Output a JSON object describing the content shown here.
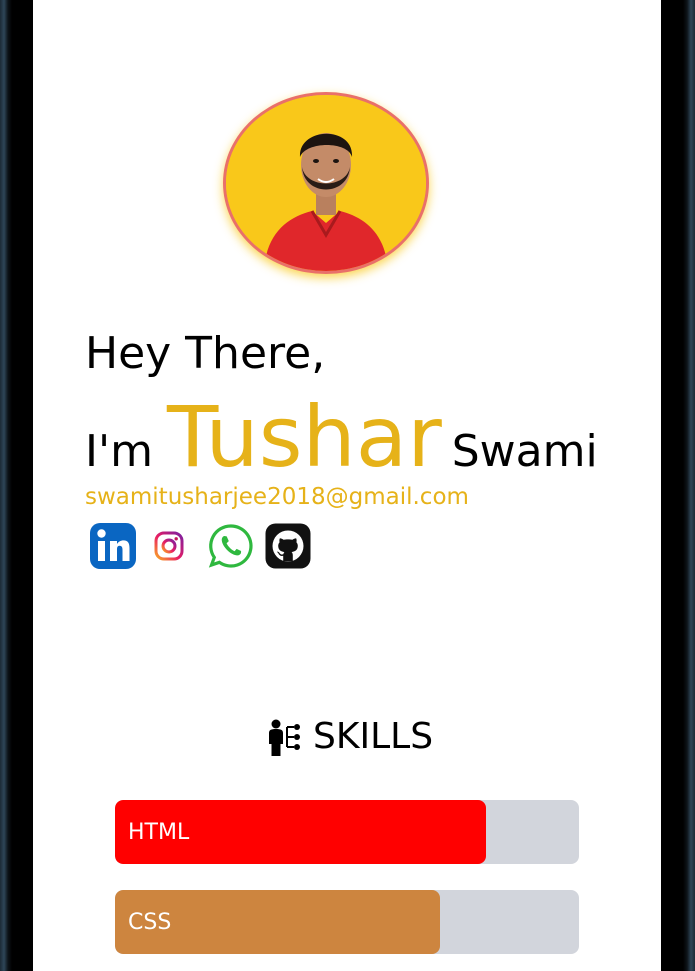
{
  "profile": {
    "greeting": "Hey There,",
    "intro_prefix": "I'm",
    "first_name": "Tushar",
    "last_name": "Swami",
    "email": "swamitusharjee2018@gmail.com"
  },
  "socials": [
    {
      "name": "LinkedIn",
      "icon": "linkedin-icon"
    },
    {
      "name": "Instagram",
      "icon": "instagram-icon"
    },
    {
      "name": "WhatsApp",
      "icon": "whatsapp-icon"
    },
    {
      "name": "GitHub",
      "icon": "github-icon"
    }
  ],
  "skills": {
    "heading": "SKILLS",
    "icon": "skills-person-icon",
    "items": [
      {
        "label": "HTML",
        "level": 0.8,
        "color": "#ff0000"
      },
      {
        "label": "CSS",
        "level": 0.7,
        "color": "#cd853f"
      }
    ]
  },
  "colors": {
    "accent": "#e6b219",
    "avatar_bg": "#f9c81a",
    "avatar_border": "#e9706a",
    "bar_track": "#d2d5dc"
  }
}
